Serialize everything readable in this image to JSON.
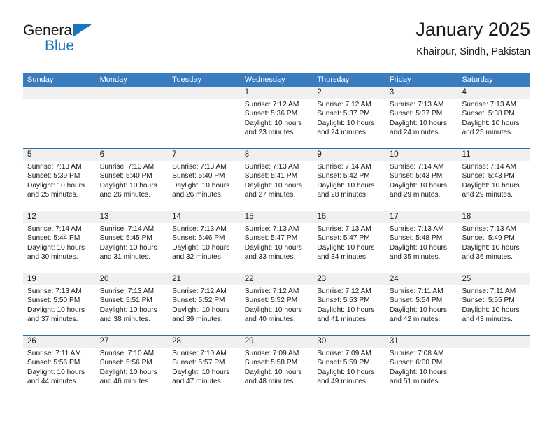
{
  "brand": {
    "name_part1": "General",
    "name_part2": "Blue",
    "logo_icon": "triangle-flag-icon"
  },
  "header": {
    "title": "January 2025",
    "location": "Khairpur, Sindh, Pakistan"
  },
  "calendar": {
    "weekday_headers": [
      "Sunday",
      "Monday",
      "Tuesday",
      "Wednesday",
      "Thursday",
      "Friday",
      "Saturday"
    ],
    "accent_color": "#3a7cc0",
    "rule_color": "#2e6da4",
    "band_color": "#f0f0f0",
    "weeks": [
      [
        {
          "day": "",
          "lines": []
        },
        {
          "day": "",
          "lines": []
        },
        {
          "day": "",
          "lines": []
        },
        {
          "day": "1",
          "lines": [
            "Sunrise: 7:12 AM",
            "Sunset: 5:36 PM",
            "Daylight: 10 hours",
            "and 23 minutes."
          ]
        },
        {
          "day": "2",
          "lines": [
            "Sunrise: 7:12 AM",
            "Sunset: 5:37 PM",
            "Daylight: 10 hours",
            "and 24 minutes."
          ]
        },
        {
          "day": "3",
          "lines": [
            "Sunrise: 7:13 AM",
            "Sunset: 5:37 PM",
            "Daylight: 10 hours",
            "and 24 minutes."
          ]
        },
        {
          "day": "4",
          "lines": [
            "Sunrise: 7:13 AM",
            "Sunset: 5:38 PM",
            "Daylight: 10 hours",
            "and 25 minutes."
          ]
        }
      ],
      [
        {
          "day": "5",
          "lines": [
            "Sunrise: 7:13 AM",
            "Sunset: 5:39 PM",
            "Daylight: 10 hours",
            "and 25 minutes."
          ]
        },
        {
          "day": "6",
          "lines": [
            "Sunrise: 7:13 AM",
            "Sunset: 5:40 PM",
            "Daylight: 10 hours",
            "and 26 minutes."
          ]
        },
        {
          "day": "7",
          "lines": [
            "Sunrise: 7:13 AM",
            "Sunset: 5:40 PM",
            "Daylight: 10 hours",
            "and 26 minutes."
          ]
        },
        {
          "day": "8",
          "lines": [
            "Sunrise: 7:13 AM",
            "Sunset: 5:41 PM",
            "Daylight: 10 hours",
            "and 27 minutes."
          ]
        },
        {
          "day": "9",
          "lines": [
            "Sunrise: 7:14 AM",
            "Sunset: 5:42 PM",
            "Daylight: 10 hours",
            "and 28 minutes."
          ]
        },
        {
          "day": "10",
          "lines": [
            "Sunrise: 7:14 AM",
            "Sunset: 5:43 PM",
            "Daylight: 10 hours",
            "and 29 minutes."
          ]
        },
        {
          "day": "11",
          "lines": [
            "Sunrise: 7:14 AM",
            "Sunset: 5:43 PM",
            "Daylight: 10 hours",
            "and 29 minutes."
          ]
        }
      ],
      [
        {
          "day": "12",
          "lines": [
            "Sunrise: 7:14 AM",
            "Sunset: 5:44 PM",
            "Daylight: 10 hours",
            "and 30 minutes."
          ]
        },
        {
          "day": "13",
          "lines": [
            "Sunrise: 7:14 AM",
            "Sunset: 5:45 PM",
            "Daylight: 10 hours",
            "and 31 minutes."
          ]
        },
        {
          "day": "14",
          "lines": [
            "Sunrise: 7:13 AM",
            "Sunset: 5:46 PM",
            "Daylight: 10 hours",
            "and 32 minutes."
          ]
        },
        {
          "day": "15",
          "lines": [
            "Sunrise: 7:13 AM",
            "Sunset: 5:47 PM",
            "Daylight: 10 hours",
            "and 33 minutes."
          ]
        },
        {
          "day": "16",
          "lines": [
            "Sunrise: 7:13 AM",
            "Sunset: 5:47 PM",
            "Daylight: 10 hours",
            "and 34 minutes."
          ]
        },
        {
          "day": "17",
          "lines": [
            "Sunrise: 7:13 AM",
            "Sunset: 5:48 PM",
            "Daylight: 10 hours",
            "and 35 minutes."
          ]
        },
        {
          "day": "18",
          "lines": [
            "Sunrise: 7:13 AM",
            "Sunset: 5:49 PM",
            "Daylight: 10 hours",
            "and 36 minutes."
          ]
        }
      ],
      [
        {
          "day": "19",
          "lines": [
            "Sunrise: 7:13 AM",
            "Sunset: 5:50 PM",
            "Daylight: 10 hours",
            "and 37 minutes."
          ]
        },
        {
          "day": "20",
          "lines": [
            "Sunrise: 7:13 AM",
            "Sunset: 5:51 PM",
            "Daylight: 10 hours",
            "and 38 minutes."
          ]
        },
        {
          "day": "21",
          "lines": [
            "Sunrise: 7:12 AM",
            "Sunset: 5:52 PM",
            "Daylight: 10 hours",
            "and 39 minutes."
          ]
        },
        {
          "day": "22",
          "lines": [
            "Sunrise: 7:12 AM",
            "Sunset: 5:52 PM",
            "Daylight: 10 hours",
            "and 40 minutes."
          ]
        },
        {
          "day": "23",
          "lines": [
            "Sunrise: 7:12 AM",
            "Sunset: 5:53 PM",
            "Daylight: 10 hours",
            "and 41 minutes."
          ]
        },
        {
          "day": "24",
          "lines": [
            "Sunrise: 7:11 AM",
            "Sunset: 5:54 PM",
            "Daylight: 10 hours",
            "and 42 minutes."
          ]
        },
        {
          "day": "25",
          "lines": [
            "Sunrise: 7:11 AM",
            "Sunset: 5:55 PM",
            "Daylight: 10 hours",
            "and 43 minutes."
          ]
        }
      ],
      [
        {
          "day": "26",
          "lines": [
            "Sunrise: 7:11 AM",
            "Sunset: 5:56 PM",
            "Daylight: 10 hours",
            "and 44 minutes."
          ]
        },
        {
          "day": "27",
          "lines": [
            "Sunrise: 7:10 AM",
            "Sunset: 5:56 PM",
            "Daylight: 10 hours",
            "and 46 minutes."
          ]
        },
        {
          "day": "28",
          "lines": [
            "Sunrise: 7:10 AM",
            "Sunset: 5:57 PM",
            "Daylight: 10 hours",
            "and 47 minutes."
          ]
        },
        {
          "day": "29",
          "lines": [
            "Sunrise: 7:09 AM",
            "Sunset: 5:58 PM",
            "Daylight: 10 hours",
            "and 48 minutes."
          ]
        },
        {
          "day": "30",
          "lines": [
            "Sunrise: 7:09 AM",
            "Sunset: 5:59 PM",
            "Daylight: 10 hours",
            "and 49 minutes."
          ]
        },
        {
          "day": "31",
          "lines": [
            "Sunrise: 7:08 AM",
            "Sunset: 6:00 PM",
            "Daylight: 10 hours",
            "and 51 minutes."
          ]
        },
        {
          "day": "",
          "lines": []
        }
      ]
    ]
  }
}
